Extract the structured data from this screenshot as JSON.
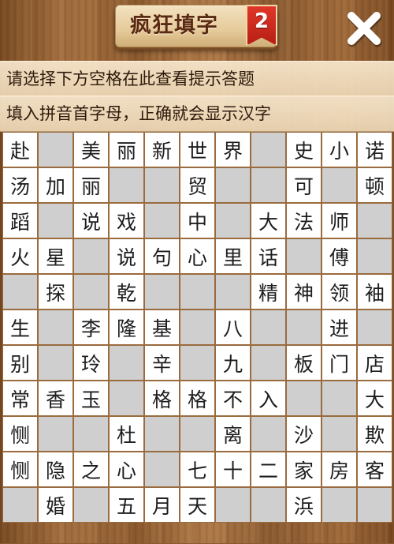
{
  "header": {
    "title": "疯狂填字",
    "level_badge": "2",
    "close_icon": "close-icon"
  },
  "hints": {
    "line1": "请选择下方空格在此查看提示答题",
    "line2": "填入拼音首字母，正确就会显示汉字"
  },
  "colors": {
    "cell_fill": "#ffffff",
    "cell_blank": "#cfcfcf",
    "grid_line": "#9a6b3e",
    "badge": "#c8281c"
  },
  "grid": [
    [
      "赴",
      null,
      "美",
      "丽",
      "新",
      "世",
      "界",
      null,
      "史",
      "小",
      "诺"
    ],
    [
      "汤",
      "加",
      "丽",
      null,
      null,
      "贸",
      null,
      null,
      "可",
      null,
      "顿"
    ],
    [
      "蹈",
      null,
      "说",
      "戏",
      null,
      "中",
      null,
      "大",
      "法",
      "师",
      null
    ],
    [
      "火",
      "星",
      null,
      "说",
      "句",
      "心",
      "里",
      "话",
      null,
      "傅",
      null
    ],
    [
      null,
      "探",
      null,
      "乾",
      null,
      null,
      null,
      "精",
      "神",
      "领",
      "袖"
    ],
    [
      "生",
      null,
      "李",
      "隆",
      "基",
      null,
      "八",
      null,
      null,
      "进",
      null
    ],
    [
      "别",
      null,
      "玲",
      null,
      "辛",
      null,
      "九",
      null,
      "板",
      "门",
      "店"
    ],
    [
      "常",
      "香",
      "玉",
      null,
      "格",
      "格",
      "不",
      "入",
      null,
      null,
      "大"
    ],
    [
      "恻",
      null,
      null,
      "杜",
      null,
      null,
      "离",
      null,
      "沙",
      null,
      "欺"
    ],
    [
      "恻",
      "隐",
      "之",
      "心",
      null,
      "七",
      "十",
      "二",
      "家",
      "房",
      "客"
    ],
    [
      null,
      "婚",
      null,
      "五",
      "月",
      "天",
      null,
      null,
      "浜",
      null,
      null
    ]
  ]
}
